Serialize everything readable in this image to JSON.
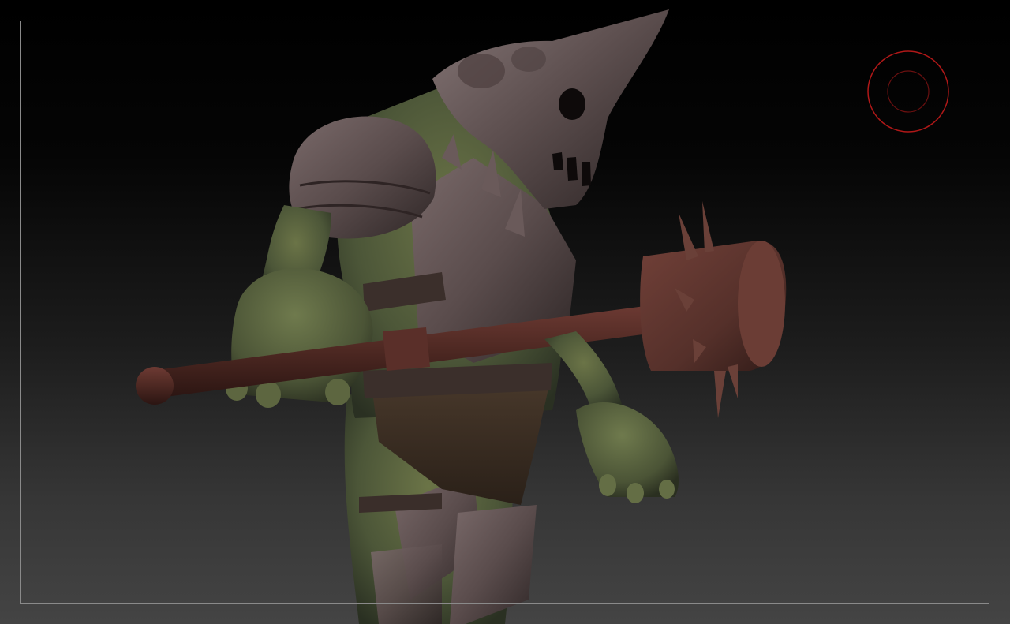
{
  "app": {
    "mode": "3d-viewport"
  },
  "viewport": {
    "background_top": "#000000",
    "background_bottom": "#444444",
    "frame_color": "#8a8a8a"
  },
  "gizmo": {
    "icon": "view-rotate-gizmo-icon",
    "color": "#b01818"
  },
  "model": {
    "skin_color": "#4f5a3a",
    "armor_color": "#5a4a4a",
    "weapon_color": "#5a2e28"
  }
}
